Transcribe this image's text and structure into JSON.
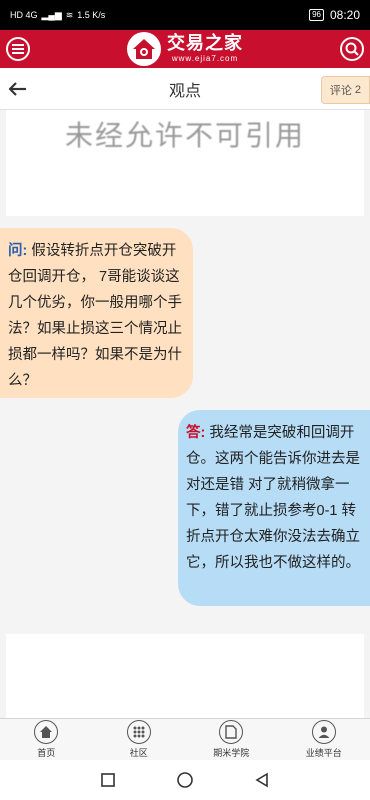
{
  "status_bar": {
    "left_text": "HD 4G",
    "speed": "1.5 K/s",
    "battery": "96",
    "time": "08:20"
  },
  "header": {
    "logo_title": "交易之家",
    "logo_url": "www.ejia7.com"
  },
  "nav": {
    "title": "观点",
    "comment_label": "评论",
    "comment_count": "2"
  },
  "image_card": {
    "watermark": "未经允许不可引用"
  },
  "question": {
    "prefix": "问:",
    "text": "假设转折点开仓突破开仓回调开仓， 7哥能谈谈这几个优劣，你一般用哪个手法？如果止损这三个情况止损都一样吗？如果不是为什么？"
  },
  "answer": {
    "prefix": "答:",
    "text": "我经常是突破和回调开仓。这两个能告诉你进去是对还是错 对了就稍微拿一下，错了就止损参考0-1  转折点开仓太难你没法去确立它，所以我也不做这样的。"
  },
  "tabs": [
    {
      "label": "首页",
      "icon": "home-icon"
    },
    {
      "label": "社区",
      "icon": "community-grid-icon"
    },
    {
      "label": "期米学院",
      "icon": "academy-document-icon"
    },
    {
      "label": "业绩平台",
      "icon": "performance-user-icon"
    }
  ],
  "colors": {
    "brand_red": "#c8102e",
    "question_bg": "#ffe0c1",
    "answer_bg": "#b7dcf6",
    "comment_bg": "#fbe8cf"
  }
}
